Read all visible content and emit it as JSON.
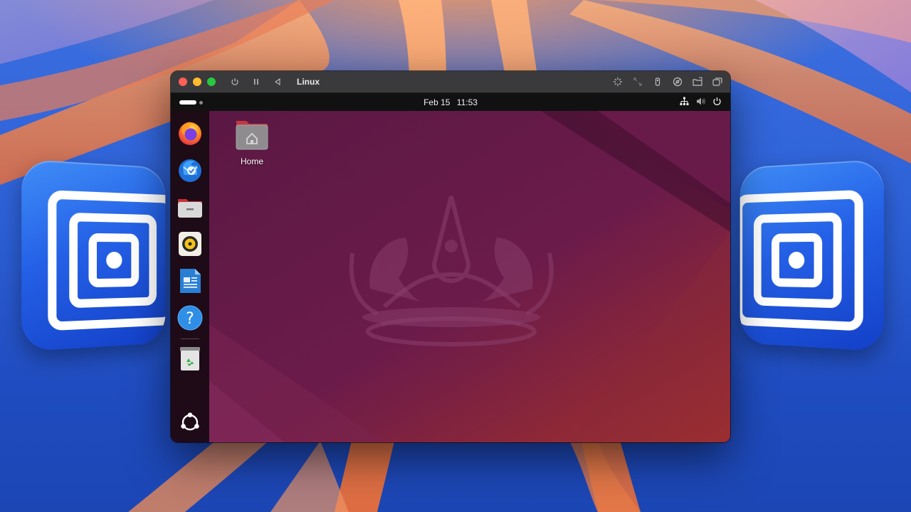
{
  "vm_window": {
    "title": "Linux",
    "toolbar_left": [
      "power-icon",
      "pause-icon",
      "back-icon"
    ],
    "toolbar_right": [
      "capture-input-icon",
      "resize-icon",
      "usb-icon",
      "drives-icon",
      "shared-folder-icon",
      "windows-icon"
    ]
  },
  "gnome_topbar": {
    "date": "Feb 15",
    "time": "11:53",
    "tray": [
      "network-icon",
      "volume-icon",
      "power-icon"
    ]
  },
  "dock": {
    "items": [
      {
        "name": "Firefox",
        "icon": "firefox-icon"
      },
      {
        "name": "Thunderbird",
        "icon": "thunderbird-icon"
      },
      {
        "name": "Files",
        "icon": "files-icon"
      },
      {
        "name": "Rhythmbox",
        "icon": "rhythmbox-icon"
      },
      {
        "name": "LibreOffice Writer",
        "icon": "libreoffice-writer-icon"
      },
      {
        "name": "Help",
        "icon": "help-icon"
      },
      {
        "name": "Trash",
        "icon": "trash-icon"
      }
    ],
    "show_apps_icon": "ubuntu-show-apps-icon"
  },
  "desktop": {
    "icons": [
      {
        "label": "Home",
        "icon": "home-folder-icon"
      }
    ]
  },
  "background_apps": [
    "utm-app-icon",
    "utm-app-icon"
  ],
  "colors": {
    "ubuntu_wallpaper": "#741c4c",
    "titlebar": "#3a3a3c",
    "topbar": "#111111",
    "mac_accent": "#2b5fd6"
  }
}
